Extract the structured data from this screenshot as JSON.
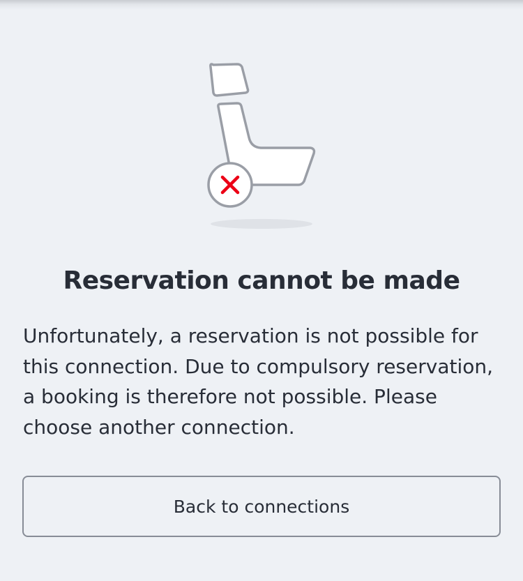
{
  "dialog": {
    "illustration_icon": "seat-unavailable-icon",
    "status_icon": "red-x-icon",
    "title": "Reservation cannot be made",
    "message": "Unfortunately, a reservation is not possible for this connection. Due to compulsory reservation, a booking is therefore not possible. Please choose another connection.",
    "back_button_label": "Back to connections"
  },
  "colors": {
    "background": "#eef1f5",
    "text": "#282d37",
    "icon_outline": "#9a9ea6",
    "error_red": "#ec0016",
    "button_border": "#878c96"
  }
}
